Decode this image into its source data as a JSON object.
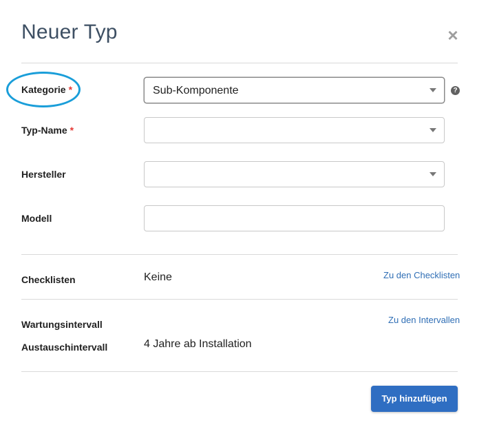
{
  "dialog": {
    "title": "Neuer Typ",
    "close_icon": "close-icon"
  },
  "form": {
    "kategorie": {
      "label": "Kategorie",
      "required_mark": "*",
      "value": "Sub-Komponente"
    },
    "typ_name": {
      "label": "Typ-Name",
      "required_mark": "*",
      "value": ""
    },
    "hersteller": {
      "label": "Hersteller",
      "value": ""
    },
    "modell": {
      "label": "Modell",
      "value": ""
    },
    "help_icon": "help-icon"
  },
  "checklists": {
    "label": "Checklisten",
    "value": "Keine",
    "link": "Zu den Checklisten"
  },
  "intervals": {
    "maintenance_label": "Wartungsintervall",
    "replacement_label": "Austauschintervall",
    "replacement_value": "4 Jahre ab Installation",
    "link": "Zu den Intervallen"
  },
  "footer": {
    "submit_label": "Typ hinzufügen"
  },
  "colors": {
    "title": "#3d4f63",
    "required": "#e53935",
    "link": "#2f6eb5",
    "primary": "#2f6ec2",
    "annotation": "#1a9ed9"
  }
}
